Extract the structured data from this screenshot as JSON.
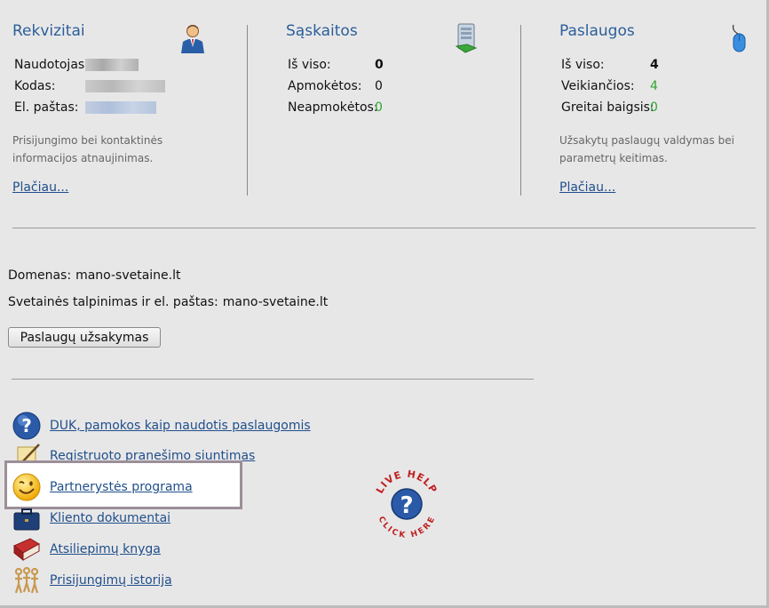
{
  "rekvizitai": {
    "title": "Rekvizitai",
    "rows": [
      {
        "label": "Naudotojas:"
      },
      {
        "label": "Kodas:"
      },
      {
        "label": "El. paštas:"
      }
    ],
    "desc_line1": "Prisijungimo bei kontaktinės",
    "desc_line2": "informacijos atnaujinimas.",
    "more": "Plačiau..."
  },
  "saskaitos": {
    "title": "Sąskaitos",
    "rows": [
      {
        "label": "Iš viso:",
        "value": "0"
      },
      {
        "label": "Apmokėtos:",
        "value": "0"
      },
      {
        "label": "Neapmokėtos:",
        "value": "0"
      }
    ]
  },
  "paslaugos": {
    "title": "Paslaugos",
    "rows": [
      {
        "label": "Iš viso:",
        "value": "4"
      },
      {
        "label": "Veikiančios:",
        "value": "4"
      },
      {
        "label": "Greitai baigsis:",
        "value": "0"
      }
    ],
    "desc_line1": "Užsakytų paslaugų valdymas bei",
    "desc_line2": "parametrų keitimas.",
    "more": "Plačiau..."
  },
  "services": {
    "domain_label": "Domenas:",
    "domain_value": "mano-svetaine.lt",
    "hosting_label": "Svetainės talpinimas ir el. paštas:",
    "hosting_value": "mano-svetaine.lt",
    "order_button": "Paslaugų užsakymas"
  },
  "links": [
    {
      "label": "DUK, pamokos kaip naudotis paslaugomis",
      "icon": "help-icon"
    },
    {
      "label": "Registruoto pranešimo siuntimas",
      "icon": "note-icon"
    },
    {
      "label": "Partnerystės programa",
      "icon": "smiley-icon"
    },
    {
      "label": "Kliento dokumentai",
      "icon": "briefcase-icon"
    },
    {
      "label": "Atsiliepimų knyga",
      "icon": "book-icon"
    },
    {
      "label": "Prisijungimų istorija",
      "icon": "people-icon"
    }
  ],
  "live_help": {
    "top": "LIVE HELP",
    "bottom": "CLICK HERE",
    "icon": "live-help-icon"
  },
  "colors": {
    "heading": "#2a5f99",
    "link": "#1f4f8a",
    "positive": "#2fa52f",
    "background": "#e8e7e8"
  }
}
